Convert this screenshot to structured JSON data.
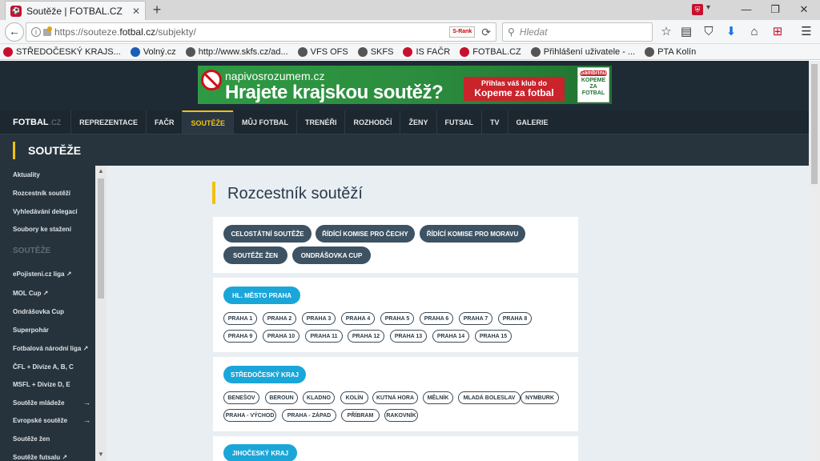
{
  "browser": {
    "tab_title": "Soutěže | FOTBAL.CZ",
    "tab_close": "✕",
    "newtab": "+",
    "url_prefix": "https://souteze.",
    "url_host": "fotbal.cz",
    "url_path": "/subjekty/",
    "srank": "S-Rank",
    "search_placeholder": "Hledat",
    "window_min": "—",
    "window_max": "❐",
    "window_close": "✕",
    "bookmarks": [
      {
        "label": "STŘEDOČESKÝ KRAJS...",
        "color": "#c8102e"
      },
      {
        "label": "Volný.cz",
        "color": "#1a5fb4"
      },
      {
        "label": "http://www.skfs.cz/ad...",
        "color": "#555555"
      },
      {
        "label": "VFS OFS",
        "color": "#555555"
      },
      {
        "label": "SKFS",
        "color": "#555555"
      },
      {
        "label": "IS FAČR",
        "color": "#c8102e"
      },
      {
        "label": "FOTBAL.CZ",
        "color": "#c8102e"
      },
      {
        "label": "Přihlášení uživatele - ...",
        "color": "#555555"
      },
      {
        "label": "PTA Kolín",
        "color": "#555555"
      }
    ]
  },
  "banner": {
    "domain": "napivosrozumem.cz",
    "headline": "Hrajete krajskou soutěž?",
    "cta_line1": "Přihlas váš klub do",
    "cta_line2": "Kopeme za fotbal",
    "brand": "Gambrinus",
    "brand_tag": "KOPEME ZA FOTBAL"
  },
  "nav": {
    "logo": "FOTBAL",
    "logo_suffix": ".CZ",
    "items": [
      "REPREZENTACE",
      "FAČR",
      "SOUTĚŽE",
      "MŮJ FOTBAL",
      "TRENÉŘI",
      "ROZHODČÍ",
      "ŽENY",
      "FUTSAL",
      "TV",
      "GALERIE"
    ],
    "active_index": 2
  },
  "section_title": "SOUTĚŽE",
  "sidebar": {
    "items_top": [
      "Aktuality",
      "Rozcestník soutěží",
      "Vyhledávání delegací",
      "Soubory ke stažení"
    ],
    "heading": "SOUTĚŽE",
    "items": [
      {
        "label": "ePojisteni.cz liga ↗",
        "arrow": ""
      },
      {
        "label": "MOL Cup ↗",
        "arrow": ""
      },
      {
        "label": "Ondrášovka Cup",
        "arrow": ""
      },
      {
        "label": "Superpohár",
        "arrow": ""
      },
      {
        "label": "Fotbalová národní liga ↗",
        "arrow": ""
      },
      {
        "label": "ČFL + Divize A, B, C",
        "arrow": ""
      },
      {
        "label": "MSFL + Divize D, E",
        "arrow": ""
      },
      {
        "label": "Soutěže mládeže",
        "arrow": "→"
      },
      {
        "label": "Evropské soutěže",
        "arrow": "→"
      },
      {
        "label": "Soutěže žen",
        "arrow": ""
      },
      {
        "label": "Soutěže futsalu ↗",
        "arrow": ""
      }
    ]
  },
  "page_title": "Rozcestník soutěží",
  "top_buttons": [
    "CELOSTÁTNÍ SOUTĚŽE",
    "ŘÍDÍCÍ KOMISE PRO ČECHY",
    "ŘÍDÍCÍ KOMISE PRO MORAVU",
    "SOUTĚŽE ŽEN",
    "ONDRÁŠOVKA CUP"
  ],
  "regions": [
    {
      "name": "HL. MĚSTO PRAHA",
      "districts": [
        "PRAHA 1",
        "PRAHA 2",
        "PRAHA 3",
        "PRAHA 4",
        "PRAHA 5",
        "PRAHA 6",
        "PRAHA 7",
        "PRAHA 8",
        "PRAHA 9",
        "PRAHA 10",
        "PRAHA 11",
        "PRAHA 12",
        "PRAHA 13",
        "PRAHA 14",
        "PRAHA 15"
      ]
    },
    {
      "name": "STŘEDOČESKÝ KRAJ",
      "districts": [
        "BENEŠOV",
        "BEROUN",
        "KLADNO",
        "KOLÍN",
        "KUTNÁ HORA",
        "MĚLNÍK",
        "MLADÁ BOLESLAV",
        "NYMBURK",
        "PRAHA - VÝCHOD",
        "PRAHA - ZÁPAD",
        "PŘÍBRAM",
        "RAKOVNÍK"
      ]
    },
    {
      "name": "JIHOČESKÝ KRAJ",
      "districts": []
    }
  ],
  "colors": {
    "accent": "#f2c10f",
    "pill_dark": "#3d5262",
    "pill_blue": "#1aa6d9",
    "header_bg": "#1e2b35"
  }
}
